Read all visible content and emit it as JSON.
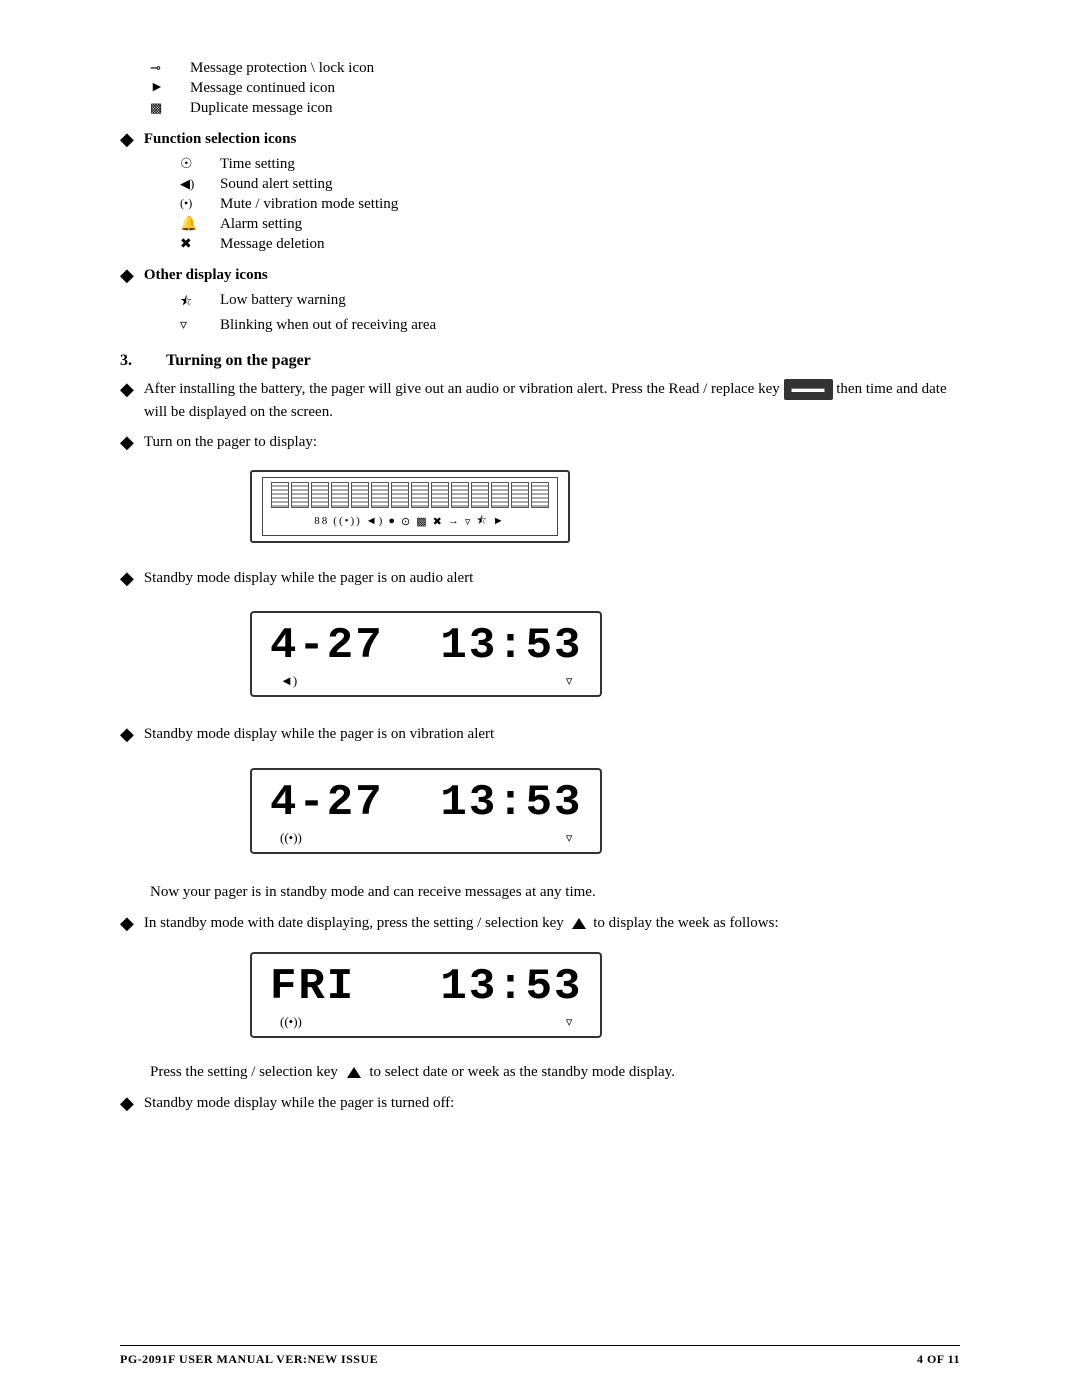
{
  "icons": {
    "message_protection": "Message protection \\ lock icon",
    "message_continued": "Message continued icon",
    "duplicate_message": "Duplicate message icon"
  },
  "function_selection": {
    "header": "Function selection icons",
    "items": [
      {
        "sym": "⊙",
        "label": "Time setting"
      },
      {
        "sym": "◄)",
        "label": "Sound alert setting"
      },
      {
        "sym": "((•))",
        "label": "Mute / vibration mode setting"
      },
      {
        "sym": "🔔",
        "label": "Alarm setting"
      },
      {
        "sym": "✂",
        "label": "Message deletion"
      }
    ]
  },
  "other_display": {
    "header": "Other display icons",
    "items": [
      {
        "sym": "⬛▶",
        "label": "Low battery warning"
      },
      {
        "sym": "▼",
        "label": "Blinking when out of receiving area"
      }
    ]
  },
  "section3": {
    "number": "3.",
    "title": "Turning on the pager",
    "bullet1": "After installing the battery, the pager will give out an audio or vibration alert. Press the Read / replace key",
    "bullet1_cont": "then time and date will be displayed on the screen.",
    "bullet2": "Turn on the pager to display:",
    "standby_audio": "Standby mode display while the pager is on audio alert",
    "standby_vibration": "Standby mode display while the pager is on vibration alert",
    "standby_note": "Now your pager is in standby mode and can receive messages at any time.",
    "standby_setting": "In standby mode with date displaying, press the setting / selection key",
    "standby_setting_cont": "to display the week as follows:",
    "press_note": "Press the setting / selection key",
    "press_note_cont": "to select date or week as the standby mode display.",
    "standby_off": "Standby mode display while the pager is turned off:",
    "display_time1": "4-27  13:53",
    "display_time2": "4-27  13:53",
    "display_fri": "FRI   13:53"
  },
  "footer": {
    "left": "PG-2091F     USER MANUAL     VER:NEW ISSUE",
    "right": "4   OF   11"
  }
}
